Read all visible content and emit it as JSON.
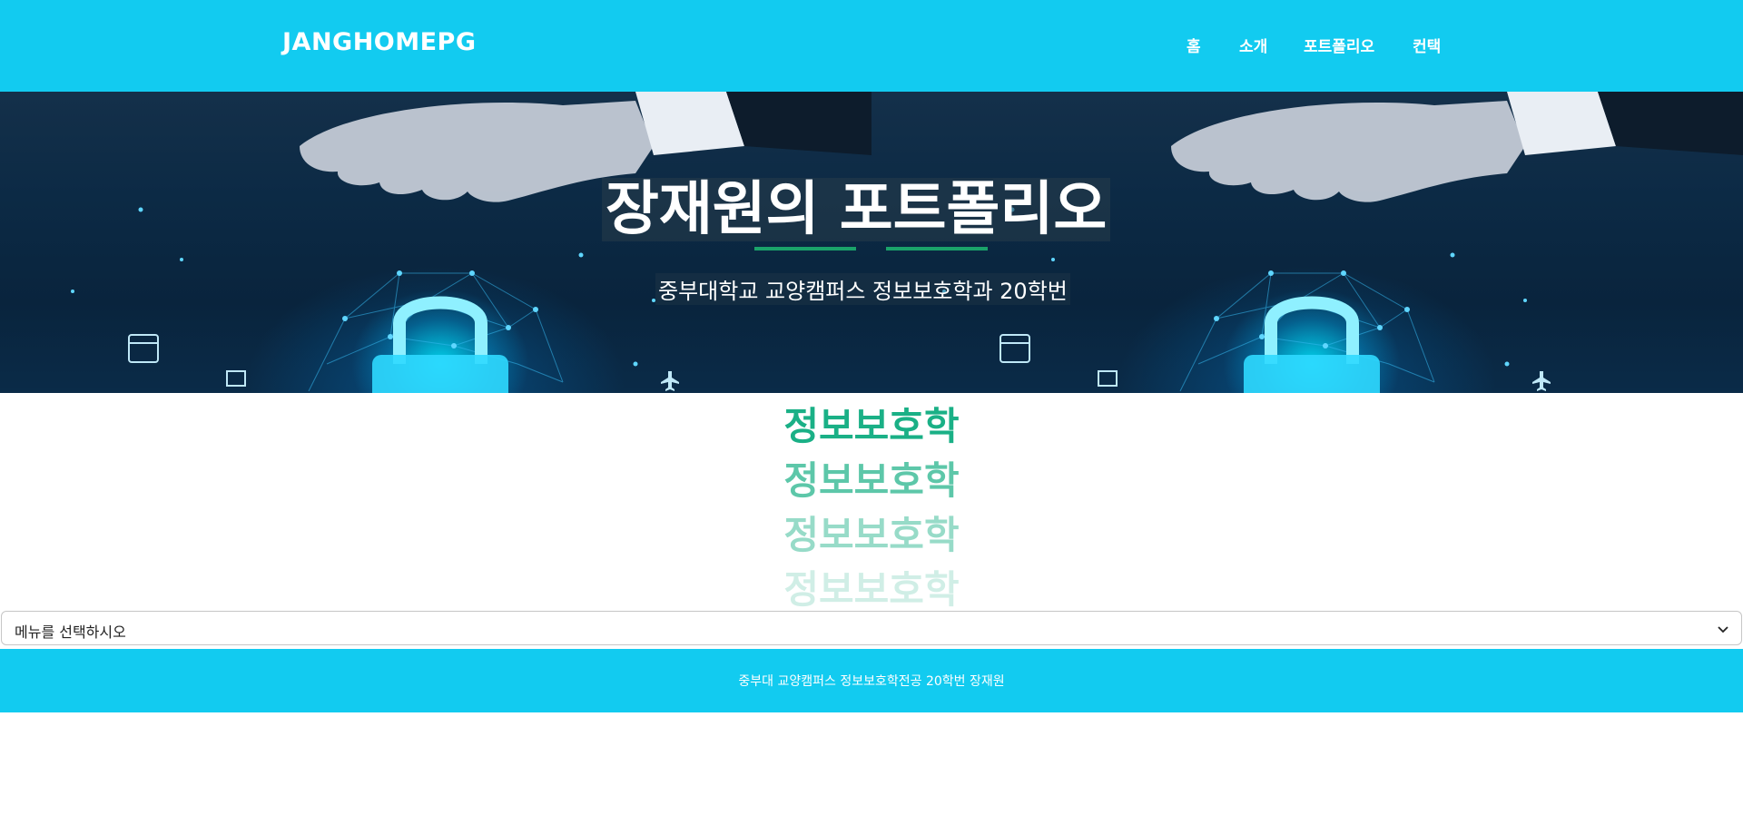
{
  "navbar": {
    "brand": "JANGHOMEPG",
    "items": [
      {
        "label": "홈"
      },
      {
        "label": "소개"
      },
      {
        "label": "포트폴리오"
      },
      {
        "label": "컨택"
      }
    ],
    "background": "#12cbf0"
  },
  "hero": {
    "title": "장재원의 포트폴리오",
    "subtitle": "중부대학교 교양캠퍼스 정보보호학과 20학번",
    "accent_line_color": "#1aa36a",
    "image_description_icons": [
      "padlock-icon",
      "calendar-icon",
      "chart-icon",
      "airplane-icon"
    ]
  },
  "fading_headings": [
    {
      "text": "정보보호학"
    },
    {
      "text": "정보보호학"
    },
    {
      "text": "정보보호학"
    },
    {
      "text": "정보보호학"
    }
  ],
  "heading_color": "#1ab086",
  "menu_select": {
    "selected": "메뉴를 선택하시오"
  },
  "footer": {
    "text": "중부대 교양캠퍼스 정보보호학전공 20학번 장재원",
    "background": "#12cbf0"
  }
}
